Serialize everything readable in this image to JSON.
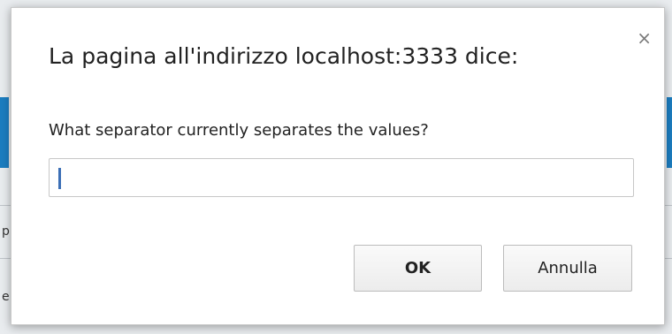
{
  "dialog": {
    "title": "La pagina all'indirizzo localhost:3333 dice:",
    "message": "What separator currently separates the values?",
    "input_value": "",
    "ok_label": "OK",
    "cancel_label": "Annulla",
    "close_glyph": "×"
  },
  "background": {
    "glyph1": "p",
    "glyph2": "e"
  },
  "colors": {
    "accent": "#1b7dc0",
    "caret": "#3c6fb6"
  },
  "icons": {
    "close": "close-icon"
  }
}
